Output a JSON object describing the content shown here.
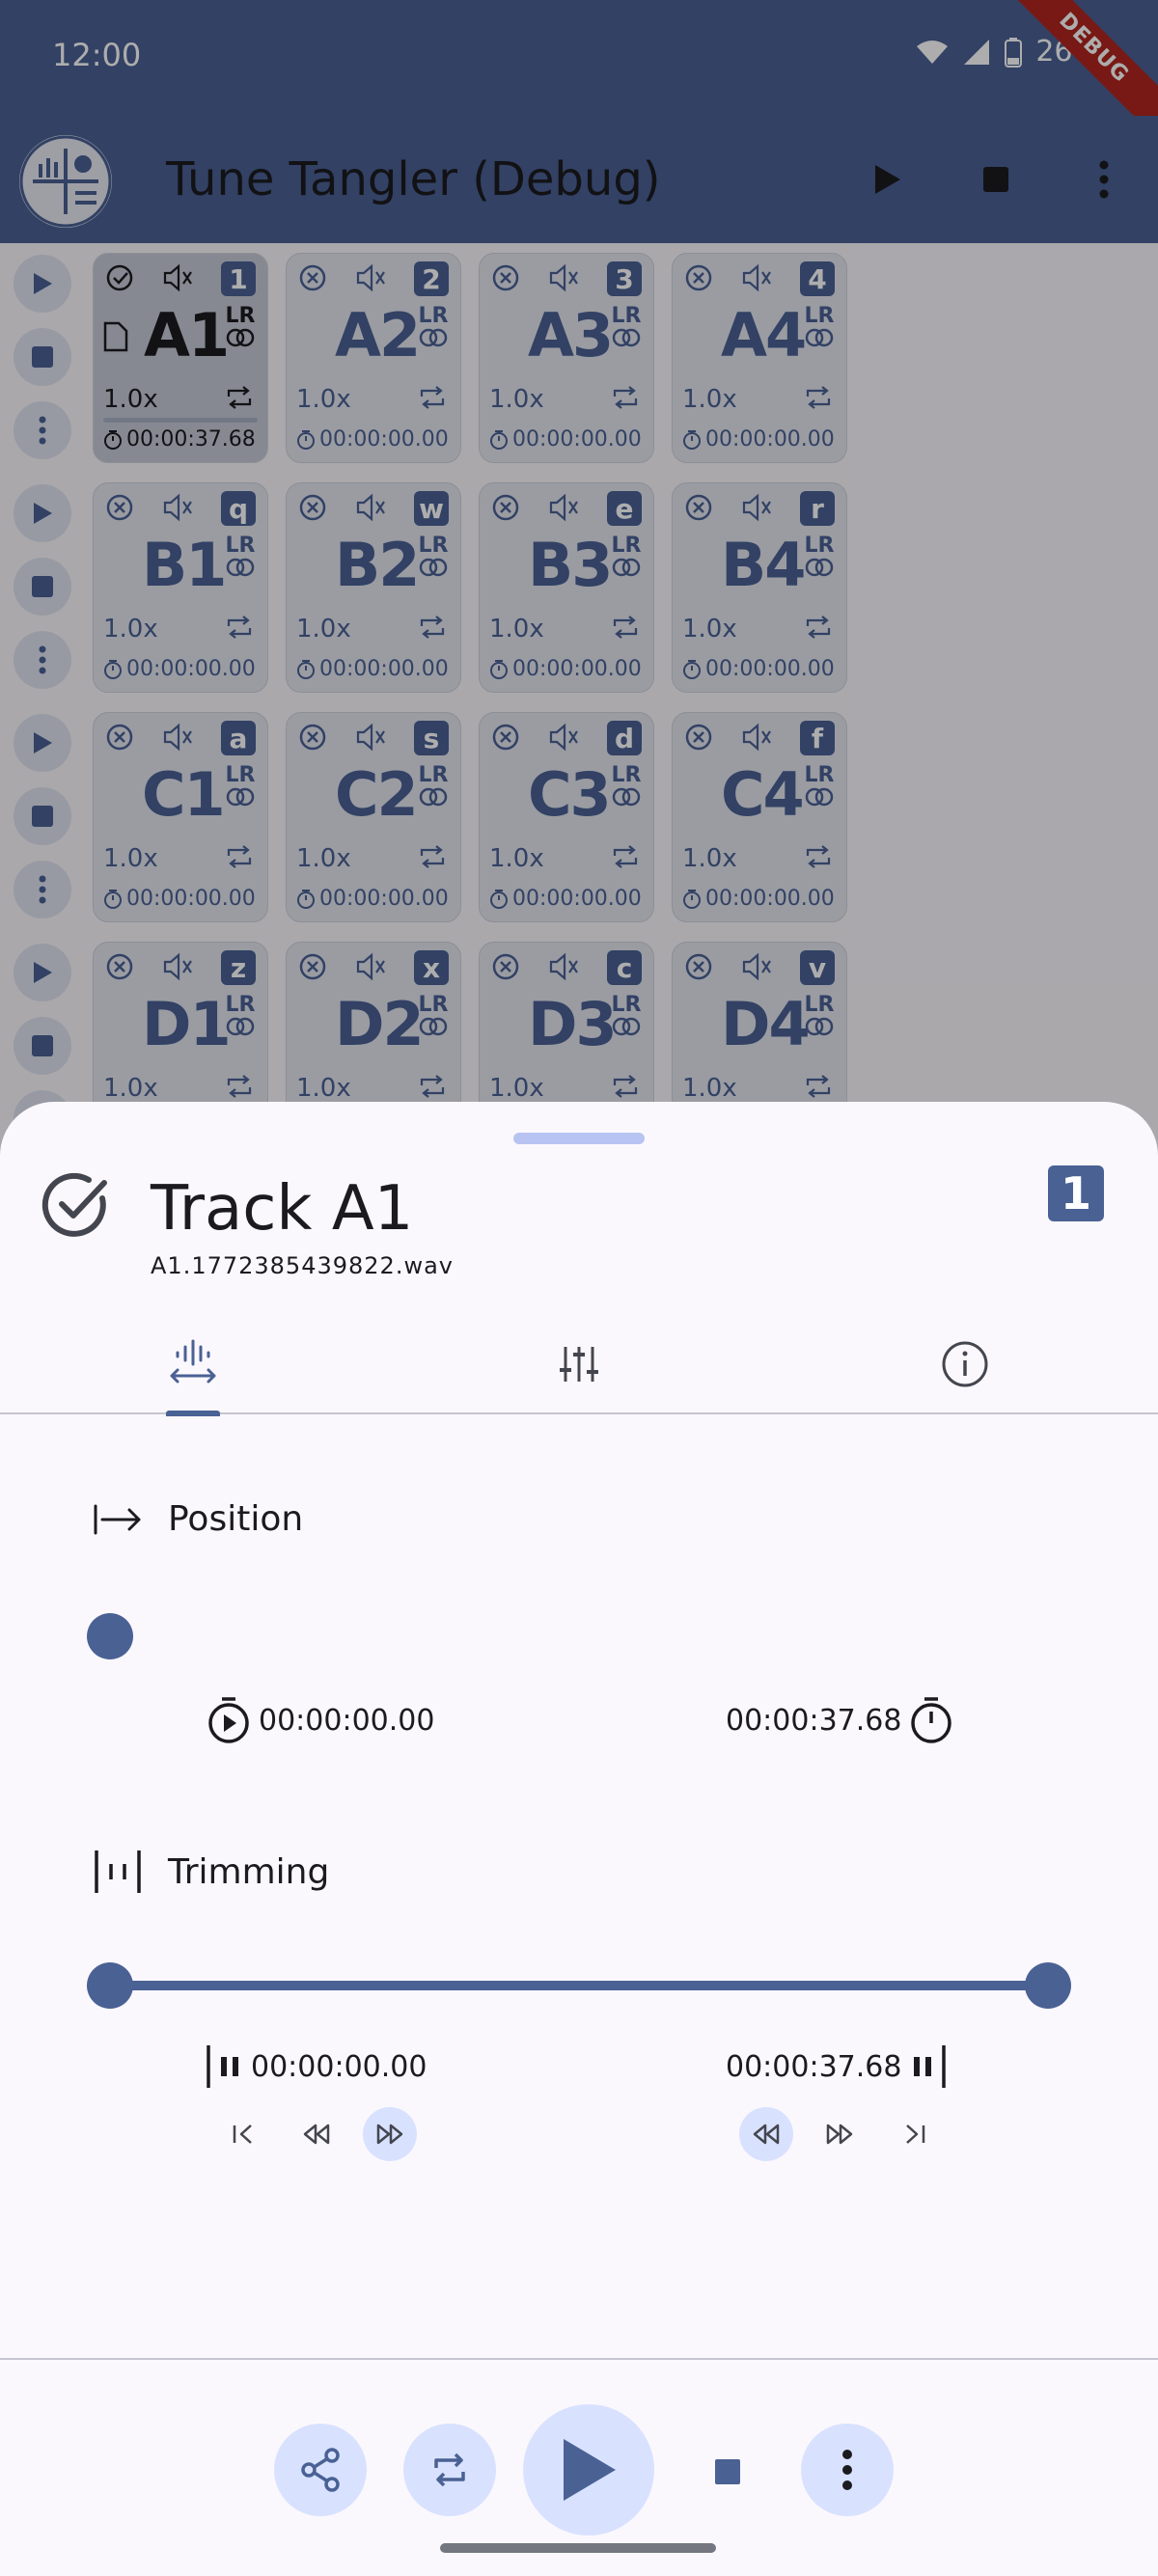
{
  "status_bar": {
    "time": "12:00",
    "battery": "26%"
  },
  "debug_banner": "DEBUG",
  "app_bar": {
    "title": "Tune Tangler (Debug)",
    "actions": [
      "play-icon",
      "stop-icon",
      "more-vert-icon"
    ]
  },
  "grid": {
    "rows": [
      {
        "tracks": [
          {
            "name": "A1",
            "key": "1",
            "speed": "1.0x",
            "time": "00:00:37.68",
            "active": true
          },
          {
            "name": "A2",
            "key": "2",
            "speed": "1.0x",
            "time": "00:00:00.00"
          },
          {
            "name": "A3",
            "key": "3",
            "speed": "1.0x",
            "time": "00:00:00.00"
          },
          {
            "name": "A4",
            "key": "4",
            "speed": "1.0x",
            "time": "00:00:00.00"
          }
        ]
      },
      {
        "tracks": [
          {
            "name": "B1",
            "key": "q",
            "speed": "1.0x",
            "time": "00:00:00.00"
          },
          {
            "name": "B2",
            "key": "w",
            "speed": "1.0x",
            "time": "00:00:00.00"
          },
          {
            "name": "B3",
            "key": "e",
            "speed": "1.0x",
            "time": "00:00:00.00"
          },
          {
            "name": "B4",
            "key": "r",
            "speed": "1.0x",
            "time": "00:00:00.00"
          }
        ]
      },
      {
        "tracks": [
          {
            "name": "C1",
            "key": "a",
            "speed": "1.0x",
            "time": "00:00:00.00"
          },
          {
            "name": "C2",
            "key": "s",
            "speed": "1.0x",
            "time": "00:00:00.00"
          },
          {
            "name": "C3",
            "key": "d",
            "speed": "1.0x",
            "time": "00:00:00.00"
          },
          {
            "name": "C4",
            "key": "f",
            "speed": "1.0x",
            "time": "00:00:00.00"
          }
        ]
      },
      {
        "tracks": [
          {
            "name": "D1",
            "key": "z",
            "speed": "1.0x",
            "time": ""
          },
          {
            "name": "D2",
            "key": "x",
            "speed": "1.0x",
            "time": ""
          },
          {
            "name": "D3",
            "key": "c",
            "speed": "1.0x",
            "time": ""
          },
          {
            "name": "D4",
            "key": "v",
            "speed": "1.0x",
            "time": ""
          }
        ]
      }
    ],
    "lr_label": "LR"
  },
  "sheet": {
    "title": "Track A1",
    "filename": "A1.1772385439822.wav",
    "key": "1",
    "tabs": [
      {
        "icon": "waveform-position-icon",
        "selected": true
      },
      {
        "icon": "tune-sliders-icon",
        "selected": false
      },
      {
        "icon": "info-icon",
        "selected": false
      }
    ],
    "position": {
      "label": "Position",
      "value": 0.0,
      "start_time": "00:00:00.00",
      "end_time": "00:00:37.68"
    },
    "trimming": {
      "label": "Trimming",
      "start": 0.0,
      "end": 1.0,
      "start_time": "00:00:00.00",
      "end_time": "00:00:37.68"
    },
    "bottom_actions": [
      "share-icon",
      "repeat-icon",
      "play-icon",
      "stop-icon",
      "more-vert-icon"
    ]
  },
  "colors": {
    "primary": "#4a6194",
    "primary_container": "#d8e2ff",
    "surface": "#fbf8fd",
    "outline": "#c4c6d0"
  }
}
